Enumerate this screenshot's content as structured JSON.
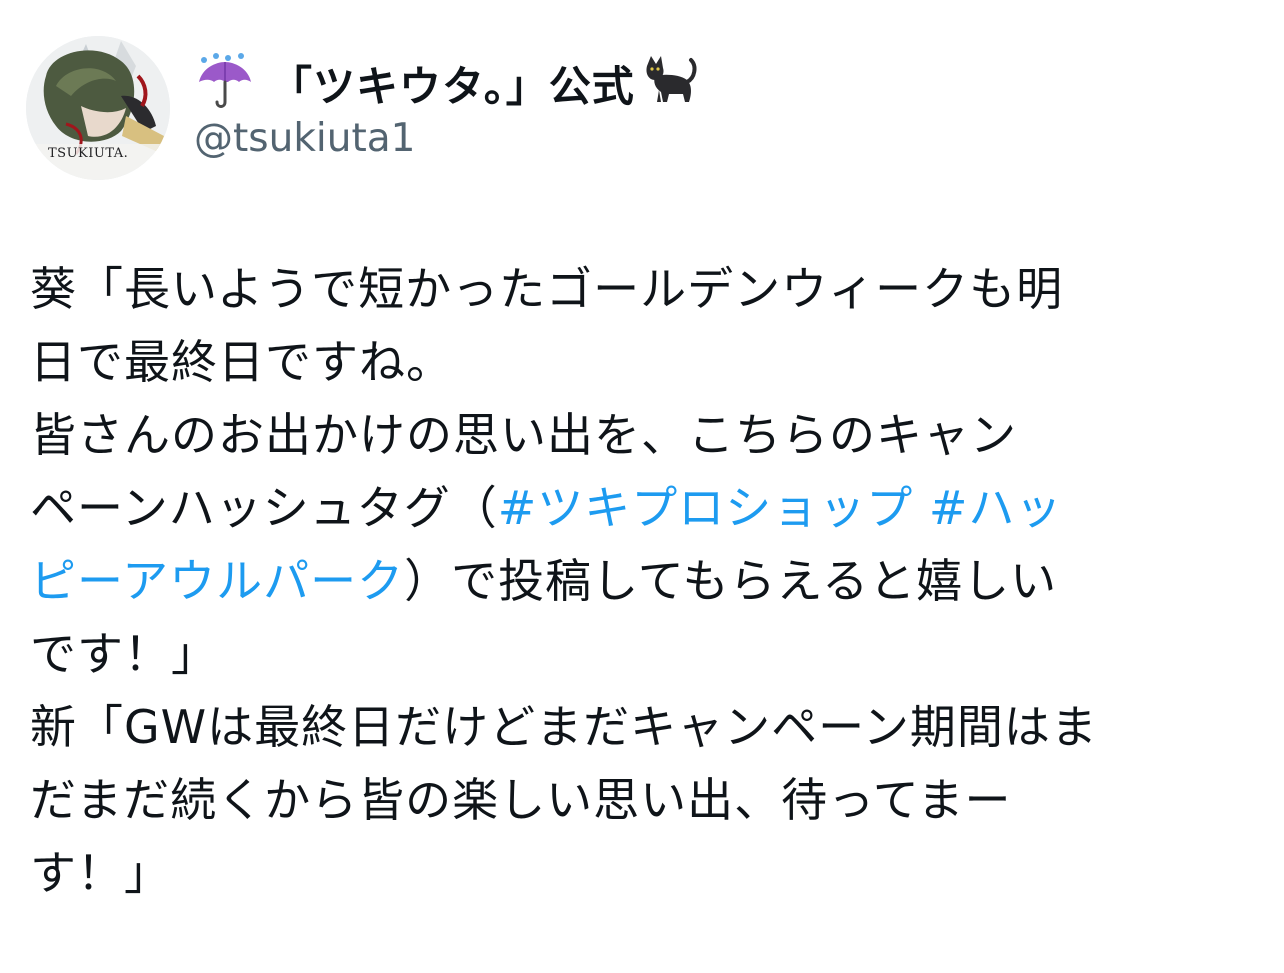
{
  "header": {
    "display_name": "「ツキウタ。」公式",
    "handle": "@tsukiuta1",
    "name_prefix_icon": "umbrella-with-rain-icon",
    "name_suffix_icon": "black-cat-icon",
    "avatar_text": "TSUKIUTA."
  },
  "tweet": {
    "hashtag_color": "#1d9bf0",
    "lines": [
      [
        {
          "text": "葵「長いようで短かったゴールデンウィークも明"
        }
      ],
      [
        {
          "text": "日で最終日ですね。"
        }
      ],
      [
        {
          "text": "皆さんのお出かけの思い出を、こちらのキャン"
        }
      ],
      [
        {
          "text": "ペーンハッシュタグ（"
        },
        {
          "text": "#ツキプロショップ",
          "hashtag": true
        },
        {
          "text": " "
        },
        {
          "text": "#ハッ",
          "hashtag": true
        }
      ],
      [
        {
          "text": "ピーアウルパーク",
          "hashtag": true
        },
        {
          "text": "）で投稿してもらえると嬉しい"
        }
      ],
      [
        {
          "text": "です！」"
        }
      ],
      [
        {
          "text": "新「GWは最終日だけどまだキャンペーン期間はま"
        }
      ],
      [
        {
          "text": "だまだ続くから皆の楽しい思い出、待ってまー"
        }
      ],
      [
        {
          "text": "す！」"
        }
      ]
    ]
  }
}
